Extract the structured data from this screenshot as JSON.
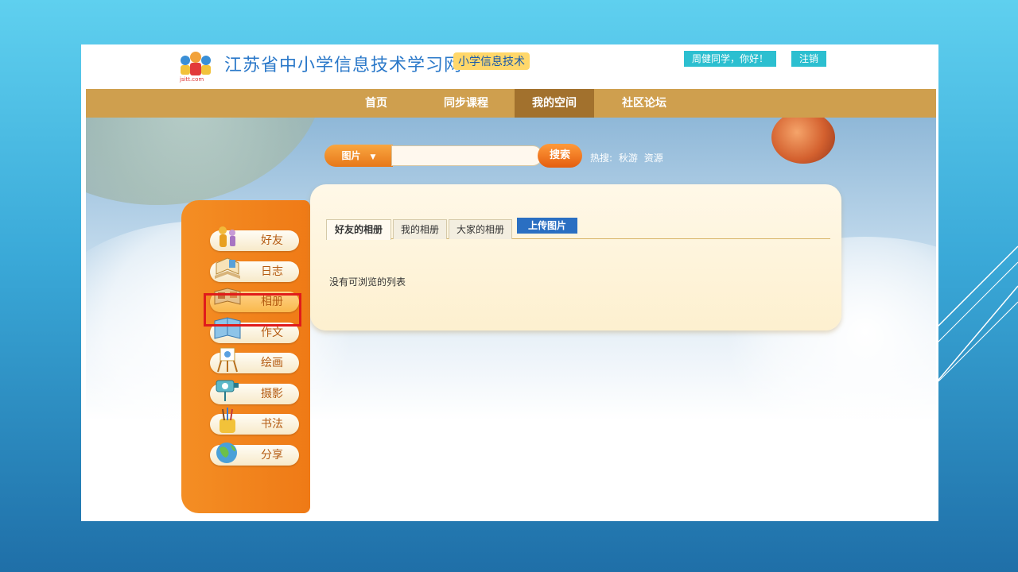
{
  "header": {
    "site_title": "江苏省中小学信息技术学习网",
    "site_badge": "小学信息技术",
    "logo_text": "jsitt.com",
    "greeting": "周健同学，你好！",
    "logout": "注销"
  },
  "nav": {
    "items": [
      "首页",
      "同步课程",
      "我的空间",
      "社区论坛"
    ],
    "active_index": 2
  },
  "search": {
    "category": "图片",
    "value": "",
    "button": "搜索",
    "hot_label": "热搜:",
    "hot_terms": [
      "秋游",
      "资源"
    ]
  },
  "sidebar": {
    "items": [
      {
        "label": "好友",
        "icon": "friends-icon"
      },
      {
        "label": "日志",
        "icon": "diary-icon"
      },
      {
        "label": "相册",
        "icon": "album-icon"
      },
      {
        "label": "作文",
        "icon": "composition-icon"
      },
      {
        "label": "绘画",
        "icon": "painting-icon"
      },
      {
        "label": "摄影",
        "icon": "camera-icon"
      },
      {
        "label": "书法",
        "icon": "calligraphy-icon"
      },
      {
        "label": "分享",
        "icon": "share-globe-icon"
      }
    ],
    "selected_index": 2
  },
  "content": {
    "tabs": [
      "好友的相册",
      "我的相册",
      "大家的相册"
    ],
    "active_tab": 0,
    "upload_button": "上传图片",
    "empty_message": "没有可浏览的列表"
  },
  "colors": {
    "nav_bg": "#cf9f4e",
    "nav_active": "#a2712d",
    "sidebar_orange": "#f48e24",
    "highlight_red": "#e01b1b",
    "upload_blue": "#2a6fc2"
  }
}
